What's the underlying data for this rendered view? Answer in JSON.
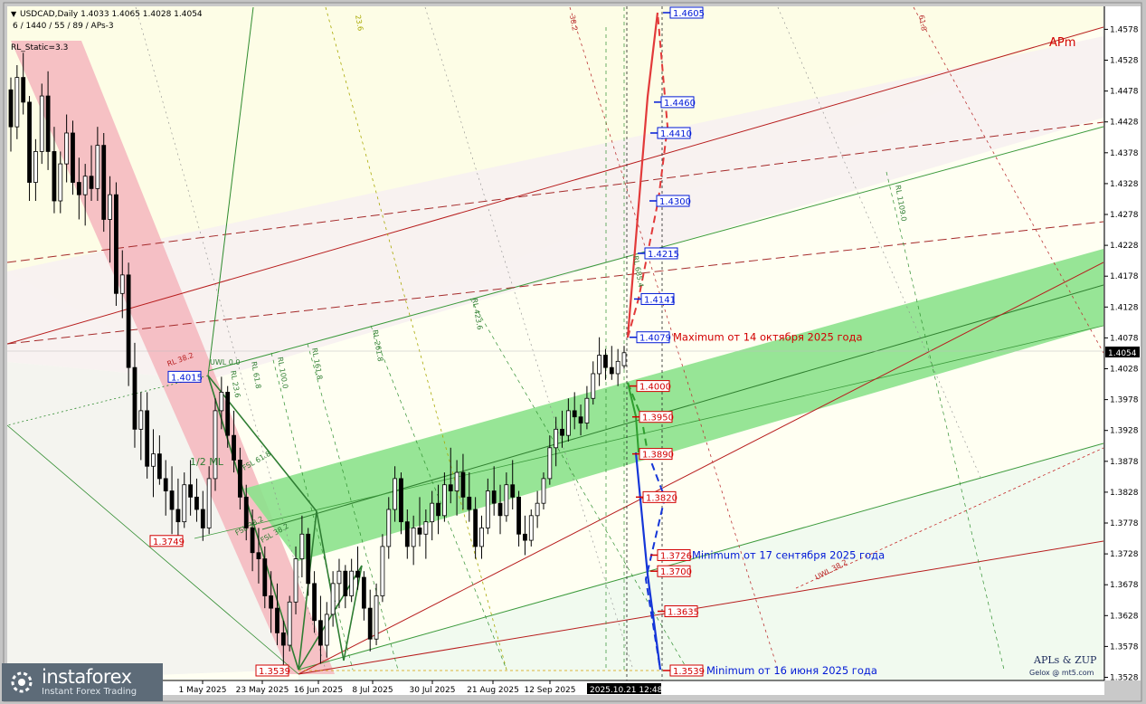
{
  "header": {
    "symbol_line": "USDCAD,Daily  1.4033 1.4065 1.4028 1.4054",
    "settings_line": "6 / 1440 / 55 / 89 / APs-3",
    "static_line": "RL_Static=3.3",
    "apm_label": "APm"
  },
  "current_price_label": "1.4054",
  "time_marker_label": "2025.10.21 12:48",
  "credits": {
    "line1": "APLs & ZUP",
    "line2": "Gelox @ mt5.com"
  },
  "watermark": {
    "brand": "instaforex",
    "tagline": "Instant Forex Trading"
  },
  "colors": {
    "background": "#fffff2",
    "candles": "#000000",
    "green_channel": "#8ce28c",
    "red_band": "#f4b6bd",
    "blue_label": "#0019d6",
    "red_label": "#d20000",
    "forecast_red": "#e23a3a",
    "forecast_blue": "#1536d8",
    "forecast_green": "#2f9e2f"
  },
  "chart_data": {
    "type": "candlestick",
    "symbol": "USDCAD",
    "timeframe": "Daily",
    "ylim": [
      1.351,
      1.462
    ],
    "y_ticks": [
      "1.4578",
      "1.4528",
      "1.4478",
      "1.4428",
      "1.4378",
      "1.4328",
      "1.4278",
      "1.4228",
      "1.4178",
      "1.4128",
      "1.4078",
      "1.4028",
      "1.3978",
      "1.3928",
      "1.3878",
      "1.3828",
      "1.3778",
      "1.3728",
      "1.3678",
      "1.3628",
      "1.3578",
      "1.3528"
    ],
    "x_ticks": [
      "1 May 2025",
      "23 May 2025",
      "16 Jun 2025",
      "8 Jul 2025",
      "30 Jul 2025",
      "21 Aug 2025",
      "12 Sep 2025"
    ],
    "ohlc": [
      [
        1.448,
        1.45,
        1.438,
        1.442
      ],
      [
        1.442,
        1.452,
        1.44,
        1.45
      ],
      [
        1.45,
        1.454,
        1.444,
        1.446
      ],
      [
        1.446,
        1.447,
        1.43,
        1.433
      ],
      [
        1.433,
        1.44,
        1.43,
        1.438
      ],
      [
        1.438,
        1.449,
        1.436,
        1.447
      ],
      [
        1.447,
        1.451,
        1.435,
        1.438
      ],
      [
        1.438,
        1.442,
        1.428,
        1.43
      ],
      [
        1.43,
        1.438,
        1.428,
        1.436
      ],
      [
        1.436,
        1.444,
        1.433,
        1.441
      ],
      [
        1.441,
        1.443,
        1.431,
        1.433
      ],
      [
        1.433,
        1.437,
        1.427,
        1.431
      ],
      [
        1.431,
        1.436,
        1.426,
        1.434
      ],
      [
        1.434,
        1.439,
        1.43,
        1.432
      ],
      [
        1.432,
        1.442,
        1.43,
        1.439
      ],
      [
        1.439,
        1.441,
        1.425,
        1.427
      ],
      [
        1.427,
        1.434,
        1.42,
        1.431
      ],
      [
        1.431,
        1.433,
        1.413,
        1.415
      ],
      [
        1.415,
        1.422,
        1.411,
        1.418
      ],
      [
        1.418,
        1.42,
        1.4,
        1.403
      ],
      [
        1.403,
        1.407,
        1.39,
        1.393
      ],
      [
        1.393,
        1.399,
        1.388,
        1.396
      ],
      [
        1.396,
        1.399,
        1.385,
        1.387
      ],
      [
        1.387,
        1.393,
        1.382,
        1.389
      ],
      [
        1.389,
        1.392,
        1.384,
        1.385
      ],
      [
        1.385,
        1.388,
        1.379,
        1.383
      ],
      [
        1.383,
        1.387,
        1.376,
        1.38
      ],
      [
        1.38,
        1.385,
        1.375,
        1.378
      ],
      [
        1.378,
        1.386,
        1.377,
        1.384
      ],
      [
        1.384,
        1.388,
        1.379,
        1.382
      ],
      [
        1.382,
        1.385,
        1.378,
        1.38
      ],
      [
        1.38,
        1.383,
        1.3749,
        1.377
      ],
      [
        1.377,
        1.387,
        1.376,
        1.385
      ],
      [
        1.385,
        1.398,
        1.383,
        1.396
      ],
      [
        1.396,
        1.4015,
        1.393,
        1.399
      ],
      [
        1.399,
        1.4,
        1.39,
        1.392
      ],
      [
        1.392,
        1.396,
        1.386,
        1.388
      ],
      [
        1.388,
        1.39,
        1.38,
        1.382
      ],
      [
        1.382,
        1.384,
        1.375,
        1.377
      ],
      [
        1.377,
        1.38,
        1.37,
        1.373
      ],
      [
        1.373,
        1.377,
        1.368,
        1.372
      ],
      [
        1.372,
        1.374,
        1.364,
        1.366
      ],
      [
        1.366,
        1.37,
        1.36,
        1.364
      ],
      [
        1.364,
        1.368,
        1.358,
        1.36
      ],
      [
        1.36,
        1.362,
        1.3539,
        1.358
      ],
      [
        1.358,
        1.366,
        1.357,
        1.365
      ],
      [
        1.365,
        1.374,
        1.363,
        1.372
      ],
      [
        1.372,
        1.379,
        1.369,
        1.376
      ],
      [
        1.376,
        1.377,
        1.366,
        1.368
      ],
      [
        1.368,
        1.37,
        1.36,
        1.362
      ],
      [
        1.362,
        1.366,
        1.355,
        1.358
      ],
      [
        1.358,
        1.365,
        1.356,
        1.363
      ],
      [
        1.363,
        1.37,
        1.361,
        1.368
      ],
      [
        1.368,
        1.372,
        1.364,
        1.37
      ],
      [
        1.37,
        1.371,
        1.364,
        1.366
      ],
      [
        1.366,
        1.372,
        1.365,
        1.37
      ],
      [
        1.37,
        1.374,
        1.367,
        1.369
      ],
      [
        1.369,
        1.37,
        1.362,
        1.364
      ],
      [
        1.364,
        1.367,
        1.357,
        1.359
      ],
      [
        1.359,
        1.368,
        1.358,
        1.366
      ],
      [
        1.366,
        1.376,
        1.365,
        1.374
      ],
      [
        1.374,
        1.382,
        1.372,
        1.38
      ],
      [
        1.38,
        1.387,
        1.378,
        1.385
      ],
      [
        1.385,
        1.386,
        1.376,
        1.378
      ],
      [
        1.378,
        1.38,
        1.372,
        1.374
      ],
      [
        1.374,
        1.379,
        1.371,
        1.377
      ],
      [
        1.377,
        1.382,
        1.374,
        1.376
      ],
      [
        1.376,
        1.38,
        1.372,
        1.378
      ],
      [
        1.378,
        1.383,
        1.375,
        1.381
      ],
      [
        1.381,
        1.384,
        1.376,
        1.379
      ],
      [
        1.379,
        1.386,
        1.378,
        1.384
      ],
      [
        1.384,
        1.39,
        1.381,
        1.383
      ],
      [
        1.383,
        1.388,
        1.379,
        1.386
      ],
      [
        1.386,
        1.389,
        1.38,
        1.382
      ],
      [
        1.382,
        1.386,
        1.378,
        1.38
      ],
      [
        1.38,
        1.382,
        1.372,
        1.374
      ],
      [
        1.374,
        1.379,
        1.372,
        1.377
      ],
      [
        1.377,
        1.385,
        1.376,
        1.383
      ],
      [
        1.383,
        1.387,
        1.379,
        1.381
      ],
      [
        1.381,
        1.384,
        1.376,
        1.379
      ],
      [
        1.379,
        1.386,
        1.378,
        1.384
      ],
      [
        1.384,
        1.388,
        1.38,
        1.382
      ],
      [
        1.382,
        1.383,
        1.374,
        1.376
      ],
      [
        1.376,
        1.379,
        1.3726,
        1.375
      ],
      [
        1.375,
        1.38,
        1.374,
        1.379
      ],
      [
        1.379,
        1.383,
        1.377,
        1.381
      ],
      [
        1.381,
        1.386,
        1.38,
        1.385
      ],
      [
        1.385,
        1.392,
        1.384,
        1.39
      ],
      [
        1.39,
        1.395,
        1.387,
        1.393
      ],
      [
        1.393,
        1.396,
        1.39,
        1.392
      ],
      [
        1.392,
        1.398,
        1.391,
        1.396
      ],
      [
        1.396,
        1.399,
        1.393,
        1.395
      ],
      [
        1.395,
        1.397,
        1.392,
        1.394
      ],
      [
        1.394,
        1.4,
        1.393,
        1.398
      ],
      [
        1.398,
        1.404,
        1.397,
        1.402
      ],
      [
        1.402,
        1.4079,
        1.4,
        1.405
      ],
      [
        1.405,
        1.406,
        1.401,
        1.403
      ],
      [
        1.403,
        1.4065,
        1.401,
        1.402
      ],
      [
        1.402,
        1.406,
        1.4,
        1.404
      ],
      [
        1.4033,
        1.4065,
        1.4028,
        1.4054
      ]
    ],
    "price_labels": [
      {
        "text": "1.4605",
        "value": 1.4605,
        "color": "blue"
      },
      {
        "text": "1.4460",
        "value": 1.446,
        "color": "blue"
      },
      {
        "text": "1.4410",
        "value": 1.441,
        "color": "blue"
      },
      {
        "text": "1.4300",
        "value": 1.43,
        "color": "blue"
      },
      {
        "text": "1.4215",
        "value": 1.4215,
        "color": "blue"
      },
      {
        "text": "1.4141",
        "value": 1.4141,
        "color": "blue"
      },
      {
        "text": "1.4079",
        "value": 1.4079,
        "color": "blue"
      },
      {
        "text": "1.4000",
        "value": 1.4,
        "color": "red"
      },
      {
        "text": "1.3950",
        "value": 1.395,
        "color": "red"
      },
      {
        "text": "1.3890",
        "value": 1.389,
        "color": "red"
      },
      {
        "text": "1.3820",
        "value": 1.382,
        "color": "red"
      },
      {
        "text": "1.3726",
        "value": 1.3726,
        "color": "red"
      },
      {
        "text": "1.3700",
        "value": 1.37,
        "color": "red"
      },
      {
        "text": "1.3635",
        "value": 1.3635,
        "color": "red"
      },
      {
        "text": "1.3539",
        "value": 1.3539,
        "color": "red"
      }
    ],
    "left_labels": [
      {
        "text": "1.4015",
        "value": 1.4015,
        "color": "blue"
      },
      {
        "text": "1.3749",
        "value": 1.3749,
        "color": "red"
      },
      {
        "text": "1.3539",
        "value": 1.3539,
        "color": "red"
      }
    ],
    "annotations": [
      {
        "text": "Maximum от 14 октября 2025 года",
        "value": 1.4079,
        "color": "red"
      },
      {
        "text": "Minimum от 17 сентября 2025 года",
        "value": 1.3726,
        "color": "blue"
      },
      {
        "text": "Minimum от 16 июня 2025 года",
        "value": 1.3539,
        "color": "blue"
      }
    ],
    "line_labels": [
      "1/2 ML",
      "UWL 38.2",
      "FSL 38.2",
      "RL 100.0",
      "RL 161.8",
      "RL 261.8",
      "RL 1109.0",
      "RL 685.4",
      "RL 423.6",
      "23.6",
      "38.2",
      "61.8",
      "UWL 0.0",
      "RL 38.2",
      "RL 23.6",
      "FSL 61.8",
      "FSL 38.2",
      "RL 61.8"
    ]
  }
}
